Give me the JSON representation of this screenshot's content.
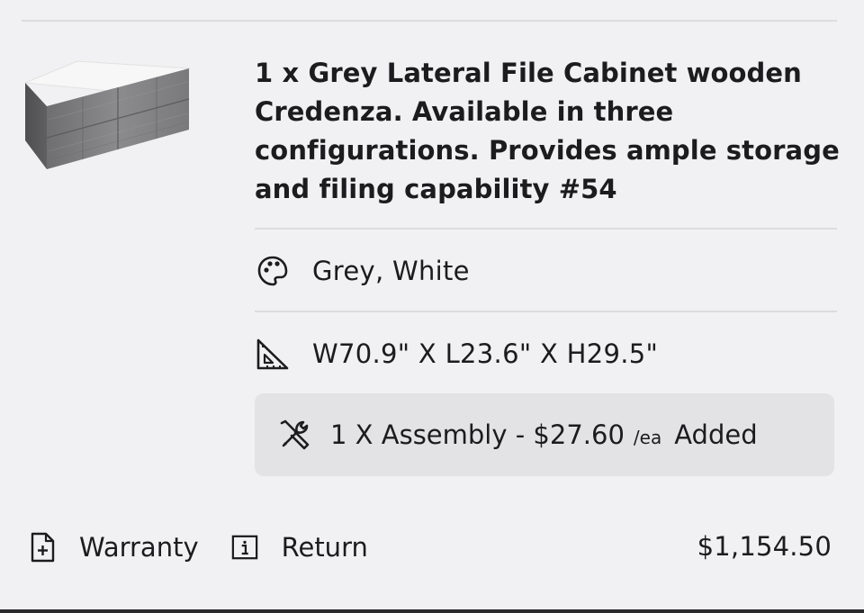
{
  "product": {
    "title": "1 x Grey Lateral File Cabinet wooden Credenza. Available in three configurations. Provides ample storage and filing capability #54",
    "image_icon": "credenza-thumbnail"
  },
  "attributes": {
    "color": {
      "icon": "palette-icon",
      "value": "Grey, White"
    },
    "dimensions": {
      "icon": "ruler-triangle-icon",
      "value": "W70.9\" X L23.6\" X H29.5\""
    }
  },
  "assembly": {
    "icon": "tools-icon",
    "label": "1 X Assembly - $27.60",
    "unit": "/ea",
    "status": "Added"
  },
  "footer": {
    "warranty_label": "Warranty",
    "warranty_icon": "document-plus-icon",
    "return_label": "Return",
    "return_icon": "info-icon",
    "price": "$1,154.50"
  }
}
